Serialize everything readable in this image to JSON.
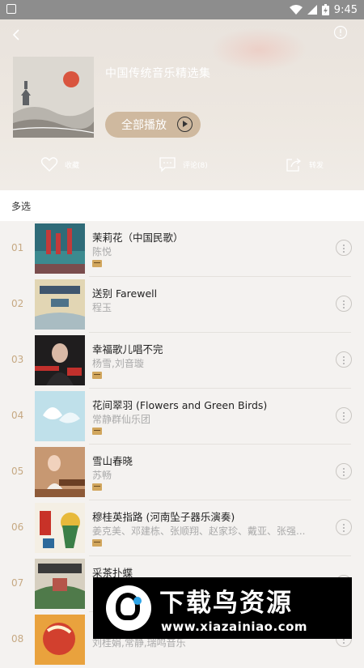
{
  "status_bar": {
    "time": "9:45"
  },
  "header": {
    "playlist_title": "中国传统音乐精选集",
    "play_all_label": "全部播放",
    "actions": {
      "favorite": "收藏",
      "comments": "评论(8)",
      "share": "转发"
    }
  },
  "multi_select_label": "多选",
  "songs": [
    {
      "index": "01",
      "title": "茉莉花（中国民歌）",
      "artist": "陈悦",
      "has_badge": true
    },
    {
      "index": "02",
      "title": "送别 Farewell",
      "artist": "程玉",
      "has_badge": false
    },
    {
      "index": "03",
      "title": "幸福歌儿唱不完",
      "artist": "杨雪,刘音璇",
      "has_badge": true
    },
    {
      "index": "04",
      "title": "花间翠羽 (Flowers and Green Birds)",
      "artist": "常静群仙乐团",
      "has_badge": true
    },
    {
      "index": "05",
      "title": "雪山春晓",
      "artist": "苏畅",
      "has_badge": true
    },
    {
      "index": "06",
      "title": "穆桂英指路 (河南坠子器乐演奏)",
      "artist": "姜克美、邓建栋、张顺翔、赵家珍、戴亚、张强...",
      "has_badge": true
    },
    {
      "index": "07",
      "title": "采茶扑蝶",
      "artist": "",
      "has_badge": false
    },
    {
      "index": "08",
      "title": "",
      "artist": "刘桂娟,常静,瑞鸣音乐",
      "has_badge": false
    }
  ],
  "watermark": {
    "title": "下载鸟资源",
    "url": "www.xiazainiao.com"
  }
}
